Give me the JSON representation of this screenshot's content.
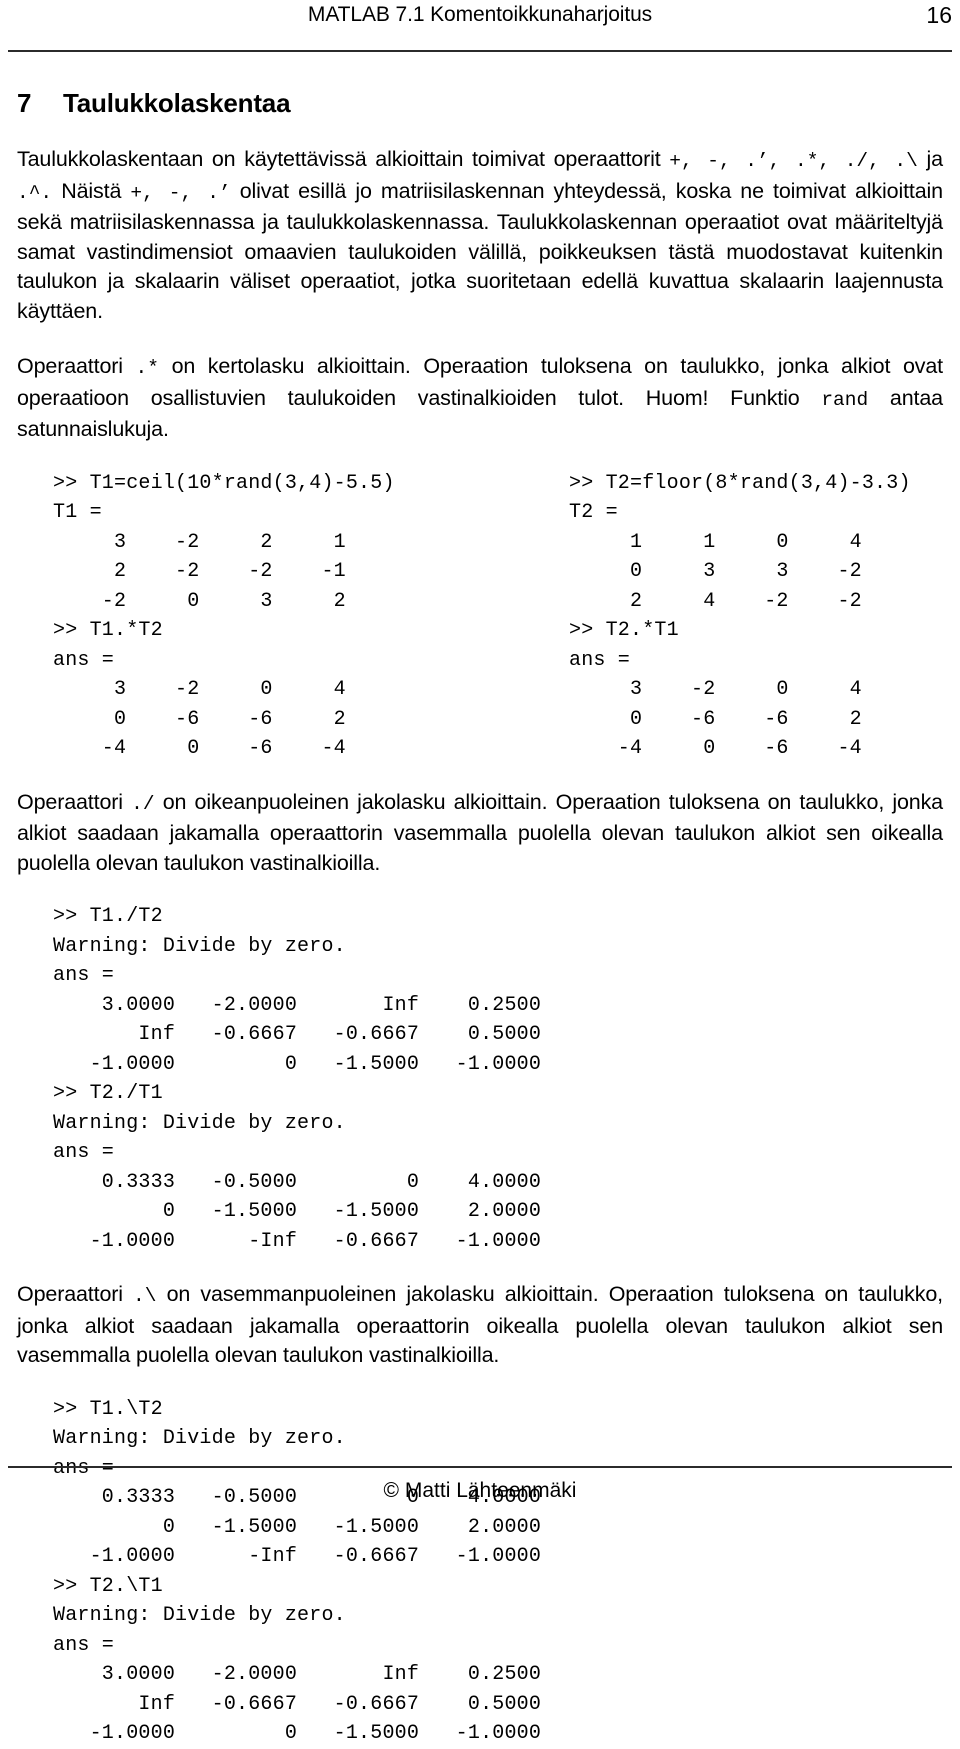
{
  "header": {
    "title": "MATLAB 7.1 Komentoikkunaharjoitus",
    "page_number": "16"
  },
  "section": {
    "number": "7",
    "title": "Taulukkolaskentaa"
  },
  "paragraphs": {
    "intro_1": "Taulukkolaskentaan on käytettävissä alkioittain toimivat operaattorit ",
    "intro_ops_1": "+, -, .’, .*, ./, .\\",
    "intro_2": " ja ",
    "intro_ops_2": ".^.",
    "intro_3": " Näistä ",
    "intro_ops_3": "+, -, .’",
    "intro_4": " olivat esillä jo matriisilaskennan yhteydessä, koska ne toimivat alkioittain sekä matriisilaskennassa ja taulukkolaskennassa. Taulukkolaskennan operaatiot ovat määriteltyjä samat vastindimensiot omaavien taulukoiden välillä, poikkeuksen tästä muodostavat kuitenkin taulukon ja skalaarin väliset operaatiot, jotka suoritetaan edellä kuvattua skalaarin laajennusta käyttäen.",
    "mult_1": "Operaattori ",
    "mult_op": ".*",
    "mult_2": " on kertolasku alkioittain. Operaation tuloksena on taulukko, jonka alkiot ovat operaatioon osallistuvien taulukoiden vastinalkioiden tulot. Huom! Funktio ",
    "mult_rand": "rand",
    "mult_3": " antaa satunnaislukuja.",
    "rdiv_1": "Operaattori ",
    "rdiv_op": "./",
    "rdiv_2": " on oikeanpuoleinen jakolasku alkioittain. Operaation tuloksena on taulukko, jonka alkiot saadaan jakamalla operaattorin vasemmalla puolella olevan taulukon alkiot sen oikealla puolella olevan taulukon vastinalkioilla.",
    "ldiv_1": "Operaattori ",
    "ldiv_op": ".\\",
    "ldiv_2": " on vasemmanpuoleinen jakolasku alkioittain. Operaation tuloksena on taulukko, jonka alkiot saadaan jakamalla operaattorin oikealla puolella olevan taulukon alkiot sen vasemmalla puolella olevan taulukon vastinalkioilla."
  },
  "console": {
    "block1_left": ">> T1=ceil(10*rand(3,4)-5.5)\nT1 =\n     3    -2     2     1\n     2    -2    -2    -1\n    -2     0     3     2\n>> T1.*T2\nans =\n     3    -2     0     4\n     0    -6    -6     2\n    -4     0    -6    -4",
    "block1_right": ">> T2=floor(8*rand(3,4)-3.3)\nT2 =\n     1     1     0     4\n     0     3     3    -2\n     2     4    -2    -2\n>> T2.*T1\nans =\n     3    -2     0     4\n     0    -6    -6     2\n    -4     0    -6    -4",
    "block2": ">> T1./T2\nWarning: Divide by zero.\nans =\n    3.0000   -2.0000       Inf    0.2500\n       Inf   -0.6667   -0.6667    0.5000\n   -1.0000         0   -1.5000   -1.0000\n>> T2./T1\nWarning: Divide by zero.\nans =\n    0.3333   -0.5000         0    4.0000\n         0   -1.5000   -1.5000    2.0000\n   -1.0000      -Inf   -0.6667   -1.0000",
    "block3": ">> T1.\\T2\nWarning: Divide by zero.\nans =\n    0.3333   -0.5000         0    4.0000\n         0   -1.5000   -1.5000    2.0000\n   -1.0000      -Inf   -0.6667   -1.0000\n>> T2.\\T1\nWarning: Divide by zero.\nans =\n    3.0000   -2.0000       Inf    0.2500\n       Inf   -0.6667   -0.6667    0.5000\n   -1.0000         0   -1.5000   -1.0000"
  },
  "footer": {
    "copyright": "© Matti Lähteenmäki"
  },
  "colors": {
    "text": "#000000",
    "rule": "#2b2b2b",
    "background": "#ffffff"
  }
}
